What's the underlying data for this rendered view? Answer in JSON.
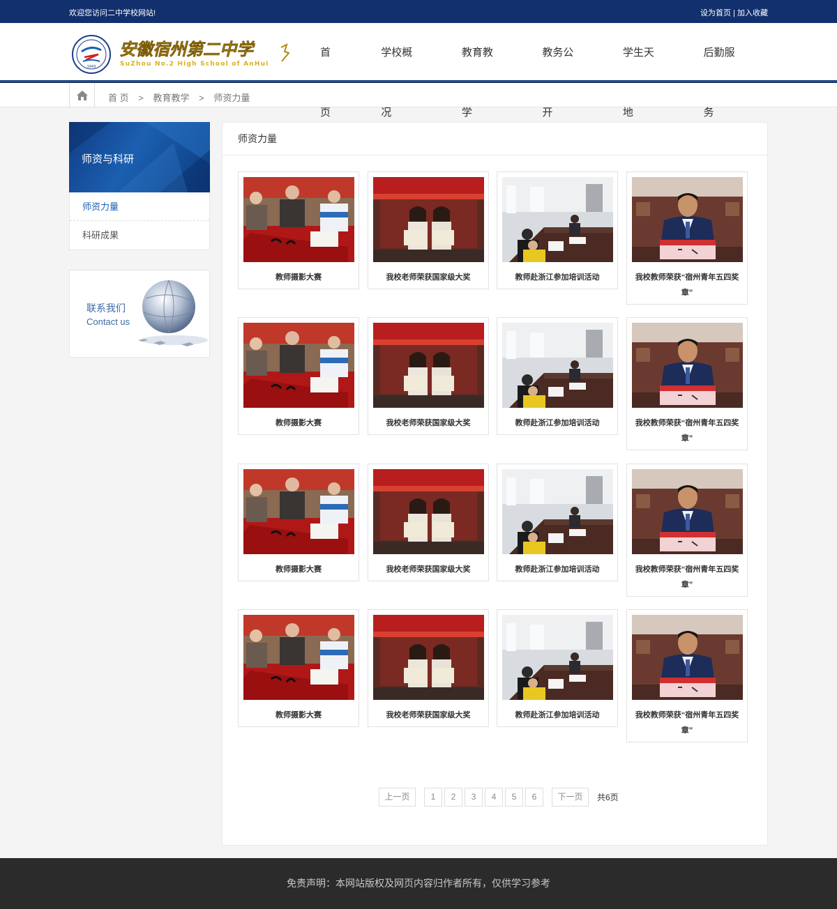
{
  "topbar": {
    "welcome": "欢迎您访问二中学校网站!",
    "set_home": "设为首页",
    "divider": "|",
    "favorite": "加入收藏"
  },
  "logo": {
    "name": "安徽宿州第二中学",
    "english": "SuZhou No.2 High School of AnHui",
    "year": "1943"
  },
  "nav": {
    "items": [
      "首页",
      "学校概况",
      "教育教学",
      "教务公开",
      "学生天地",
      "后勤服务"
    ]
  },
  "breadcrumb": {
    "home_icon": "home-icon",
    "items": [
      "首 页",
      "教育教学",
      "师资力量"
    ],
    "separator": ">"
  },
  "sidebar": {
    "title": "师资与科研",
    "items": [
      "师资力量",
      "科研成果"
    ],
    "active_index": 0,
    "contact_cn": "联系我们",
    "contact_en": "Contact us"
  },
  "main": {
    "title": "师资力量"
  },
  "photos": [
    {
      "caption": "教师摄影大赛",
      "scene": "calligraphy"
    },
    {
      "caption": "我校老师荣获国家级大奖",
      "scene": "award"
    },
    {
      "caption": "教师赴浙江参加培训活动",
      "scene": "meeting"
    },
    {
      "caption": "我校教师荣获“宿州青年五四奖章”",
      "scene": "portrait"
    },
    {
      "caption": "教师摄影大赛",
      "scene": "calligraphy"
    },
    {
      "caption": "我校老师荣获国家级大奖",
      "scene": "award"
    },
    {
      "caption": "教师赴浙江参加培训活动",
      "scene": "meeting"
    },
    {
      "caption": "我校教师荣获“宿州青年五四奖章”",
      "scene": "portrait"
    },
    {
      "caption": "教师摄影大赛",
      "scene": "calligraphy"
    },
    {
      "caption": "我校老师荣获国家级大奖",
      "scene": "award"
    },
    {
      "caption": "教师赴浙江参加培训活动",
      "scene": "meeting"
    },
    {
      "caption": "我校教师荣获“宿州青年五四奖章”",
      "scene": "portrait"
    },
    {
      "caption": "教师摄影大赛",
      "scene": "calligraphy"
    },
    {
      "caption": "我校老师荣获国家级大奖",
      "scene": "award"
    },
    {
      "caption": "教师赴浙江参加培训活动",
      "scene": "meeting"
    },
    {
      "caption": "我校教师荣获“宿州青年五四奖章”",
      "scene": "portrait"
    }
  ],
  "pagination": {
    "prev": "上一页",
    "pages": [
      "1",
      "2",
      "3",
      "4",
      "5",
      "6"
    ],
    "next": "下一页",
    "total": "共6页"
  },
  "footer": {
    "text": "免责声明：本网站版权及网页内容归作者所有，仅供学习参考"
  },
  "colors": {
    "brand": "#12306e",
    "accent": "#1a63b3",
    "footer_bg": "#2b2b2b"
  }
}
